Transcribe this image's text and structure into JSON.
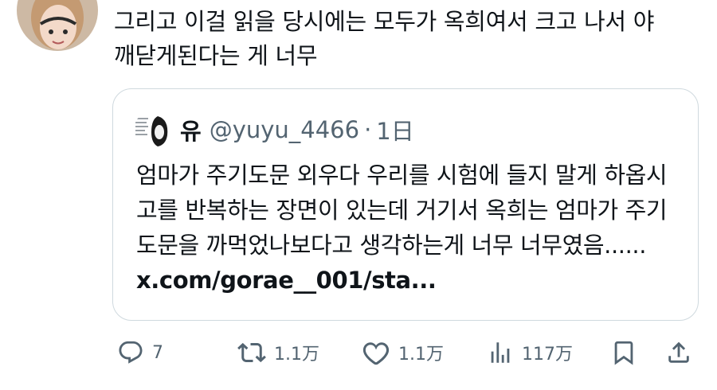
{
  "tweet": {
    "text": "그리고 이걸 읽을 당시에는 모두가 옥희여서 크고 나서 야 깨닫게된다는 게 너무"
  },
  "quote": {
    "name": "유",
    "handle": "@yuyu_4466",
    "separator": "·",
    "time": "1日",
    "text": "엄마가 주기도문 외우다 우리를 시험에 들지 말게 하옵시고를 반복하는 장면이 있는데 거기서 옥희는 엄마가 주기도문을 까먹었나보다고 생각하는게 너무 너무였음...... ",
    "link": "x.com/gorae__001/sta..."
  },
  "actions": {
    "reply": {
      "icon": "reply-icon",
      "count": "7"
    },
    "retweet": {
      "icon": "retweet-icon",
      "count": "1.1万"
    },
    "like": {
      "icon": "heart-icon",
      "count": "1.1万"
    },
    "views": {
      "icon": "views-icon",
      "count": "117万"
    },
    "bookmark": {
      "icon": "bookmark-icon"
    },
    "share": {
      "icon": "share-icon"
    }
  },
  "colors": {
    "text": "#0f1419",
    "secondary": "#536471",
    "border": "#cfd9de"
  }
}
